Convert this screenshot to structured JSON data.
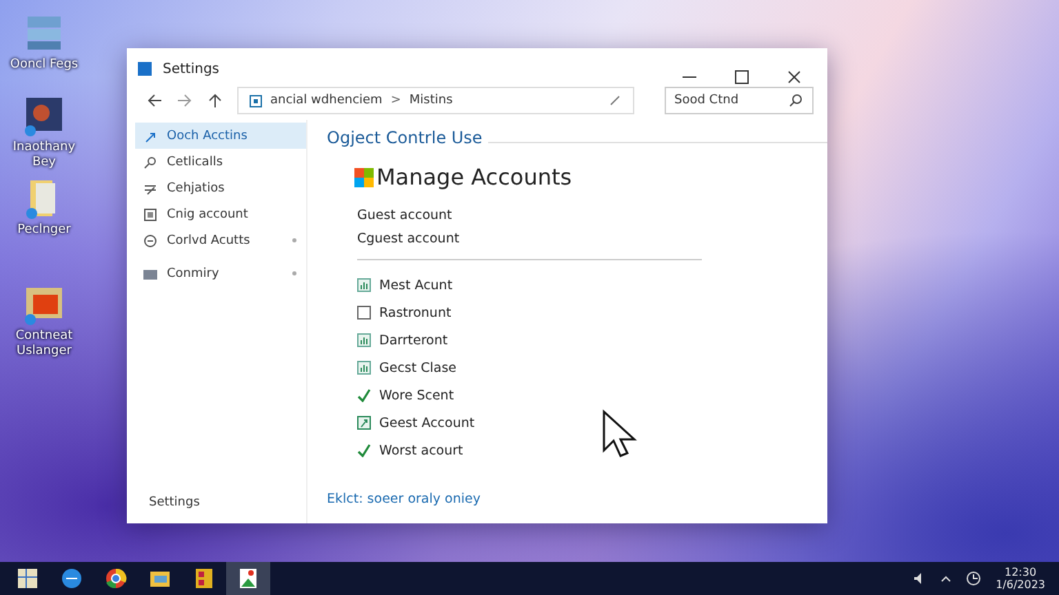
{
  "desktop_icons": [
    {
      "label": "Ooncl Fegs",
      "kind": "stack"
    },
    {
      "label": "Inaothany Bey",
      "kind": "photo"
    },
    {
      "label": "Peclnger",
      "kind": "folder"
    },
    {
      "label": "Contneat Uslanger",
      "kind": "window"
    }
  ],
  "window": {
    "title": "Settings",
    "address": {
      "path": "ancial wdhenciem",
      "separator": ">",
      "folder": "Mistins"
    },
    "search": {
      "placeholder": "Sood Ctnd"
    },
    "sidebar": {
      "items": [
        {
          "label": "Ooch Acctins",
          "selected": true,
          "expandable": false
        },
        {
          "label": "Cetlicalls",
          "selected": false,
          "expandable": false
        },
        {
          "label": "Cehjatios",
          "selected": false,
          "expandable": false
        },
        {
          "label": "Cnig account",
          "selected": false,
          "expandable": false
        },
        {
          "label": "Corlvd Acutts",
          "selected": false,
          "expandable": true
        },
        {
          "label": "Conmiry",
          "selected": false,
          "expandable": true
        }
      ],
      "footer": "Settings"
    },
    "content": {
      "section_title": "Ogject Contrle Use",
      "heading": "Manage Accounts",
      "accounts": [
        "Guest account",
        "Cguest account"
      ],
      "items": [
        {
          "label": "Mest Acunt",
          "kind": "chart"
        },
        {
          "label": "Rastronunt",
          "kind": "blank"
        },
        {
          "label": "Darrteront",
          "kind": "chart"
        },
        {
          "label": "Gecst Clase",
          "kind": "chart"
        },
        {
          "label": "Wore Scent",
          "kind": "check"
        },
        {
          "label": "Geest Account",
          "kind": "link"
        },
        {
          "label": "Worst acourt",
          "kind": "check"
        }
      ],
      "link": "Eklct: soeer oraly oniey"
    }
  },
  "taskbar": {
    "apps": [
      {
        "kind": "start",
        "selected": false
      },
      {
        "kind": "browser",
        "selected": false
      },
      {
        "kind": "chrome",
        "selected": false
      },
      {
        "kind": "folder",
        "selected": false
      },
      {
        "kind": "store",
        "selected": false
      },
      {
        "kind": "photo",
        "selected": true
      }
    ],
    "time": "12:30",
    "date": "1/6/2023"
  }
}
